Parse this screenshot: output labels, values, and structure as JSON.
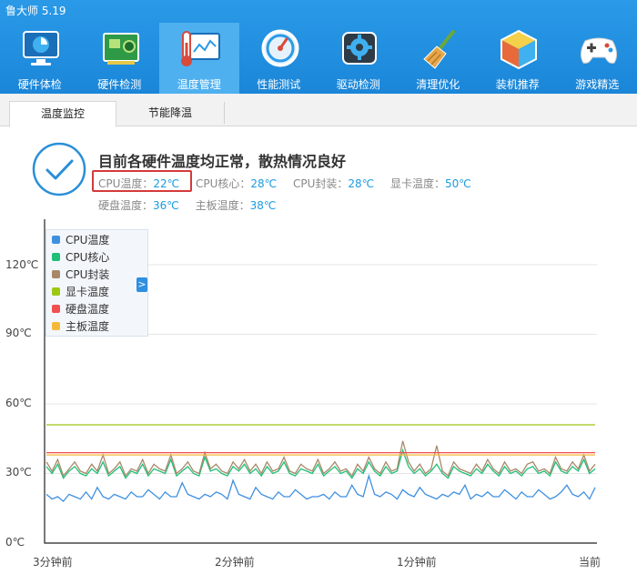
{
  "app": {
    "title": "鲁大师 5.19"
  },
  "nav": [
    {
      "label": "硬件体检",
      "icon": "monitor-check-icon"
    },
    {
      "label": "硬件检测",
      "icon": "circuit-board-icon"
    },
    {
      "label": "温度管理",
      "icon": "thermometer-icon"
    },
    {
      "label": "性能测试",
      "icon": "speedometer-icon"
    },
    {
      "label": "驱动检测",
      "icon": "driver-gear-icon"
    },
    {
      "label": "清理优化",
      "icon": "broom-icon"
    },
    {
      "label": "装机推荐",
      "icon": "cube-icon"
    },
    {
      "label": "游戏精选",
      "icon": "gamepad-icon"
    }
  ],
  "nav_active": 2,
  "tabs": [
    {
      "label": "温度监控"
    },
    {
      "label": "节能降温"
    }
  ],
  "status": {
    "title": "目前各硬件温度均正常，散热情况良好",
    "icon": "checkmark-circle-icon",
    "metrics": [
      {
        "label": "CPU温度：",
        "value": "22℃"
      },
      {
        "label": "CPU核心：",
        "value": "28℃"
      },
      {
        "label": "CPU封装：",
        "value": "28℃"
      },
      {
        "label": "显卡温度：",
        "value": "50℃"
      },
      {
        "label": "硬盘温度：",
        "value": "36℃"
      },
      {
        "label": "主板温度：",
        "value": "38℃"
      }
    ]
  },
  "legend_toggle": ">",
  "chart_data": {
    "type": "line",
    "ylim": [
      0,
      120
    ],
    "y_ticks": [
      "0℃",
      "30℃",
      "60℃",
      "90℃",
      "120℃"
    ],
    "x_ticks": [
      "3分钟前",
      "2分钟前",
      "1分钟前",
      "当前"
    ],
    "grid": true,
    "legend": "top-left",
    "series": [
      {
        "name": "CPU温度",
        "color": "#3f8fe0",
        "values": [
          21,
          19,
          20,
          18,
          21,
          20,
          19,
          22,
          19,
          24,
          20,
          19,
          21,
          20,
          19,
          22,
          20,
          20,
          23,
          21,
          19,
          22,
          20,
          20,
          26,
          21,
          20,
          19,
          21,
          20,
          22,
          21,
          19,
          27,
          21,
          20,
          19,
          24,
          21,
          20,
          19,
          22,
          20,
          20,
          23,
          21,
          19,
          20,
          20,
          21,
          19,
          22,
          20,
          20,
          25,
          21,
          20,
          29,
          21,
          20,
          22,
          21,
          19,
          23,
          21,
          20,
          24,
          21,
          20,
          19,
          21,
          20,
          22,
          21,
          25,
          19,
          21,
          20,
          22,
          20,
          20,
          23,
          21,
          19,
          22,
          20,
          20,
          23,
          21,
          19,
          20,
          22,
          25,
          21,
          20,
          22,
          19,
          24
        ]
      },
      {
        "name": "CPU核心",
        "color": "#1fbf7a",
        "values": [
          33,
          30,
          34,
          28,
          31,
          33,
          30,
          29,
          32,
          30,
          35,
          29,
          31,
          33,
          28,
          31,
          30,
          34,
          29,
          32,
          31,
          30,
          36,
          29,
          31,
          33,
          30,
          29,
          37,
          31,
          32,
          30,
          29,
          33,
          31,
          34,
          30,
          32,
          29,
          33,
          30,
          31,
          35,
          30,
          29,
          32,
          31,
          30,
          34,
          29,
          31,
          33,
          30,
          31,
          28,
          32,
          30,
          35,
          31,
          29,
          33,
          30,
          31,
          40,
          33,
          30,
          32,
          29,
          31,
          34,
          30,
          28,
          33,
          31,
          30,
          29,
          32,
          30,
          34,
          31,
          29,
          33,
          30,
          31,
          29,
          32,
          33,
          30,
          31,
          29,
          35,
          31,
          30,
          33,
          31,
          36,
          30,
          32
        ]
      },
      {
        "name": "CPU封装",
        "color": "#a98868",
        "values": [
          35,
          31,
          36,
          29,
          32,
          35,
          31,
          30,
          34,
          31,
          38,
          30,
          32,
          35,
          29,
          32,
          31,
          36,
          30,
          34,
          32,
          31,
          38,
          30,
          32,
          35,
          31,
          30,
          39,
          32,
          34,
          31,
          30,
          35,
          32,
          36,
          31,
          34,
          30,
          35,
          31,
          32,
          37,
          31,
          30,
          34,
          32,
          31,
          36,
          30,
          32,
          35,
          31,
          32,
          29,
          34,
          31,
          37,
          32,
          30,
          35,
          31,
          32,
          44,
          35,
          31,
          34,
          30,
          32,
          42,
          31,
          29,
          35,
          32,
          31,
          30,
          34,
          31,
          36,
          32,
          30,
          35,
          31,
          32,
          30,
          34,
          35,
          31,
          32,
          30,
          37,
          32,
          31,
          35,
          32,
          38,
          31,
          34
        ]
      },
      {
        "name": "显卡温度",
        "color": "#9cc813",
        "values": [
          51,
          51,
          51,
          51,
          51,
          51,
          51,
          51,
          51,
          51,
          51,
          51,
          51,
          51,
          51,
          51,
          51,
          51,
          51,
          51,
          51,
          51,
          51,
          51,
          51,
          51,
          51,
          51,
          51,
          51,
          51,
          51,
          51,
          51,
          51,
          51,
          51,
          51,
          51,
          51,
          51,
          51,
          51,
          51,
          51,
          51,
          51,
          51,
          51,
          51,
          51,
          51,
          51,
          51,
          51,
          51,
          51,
          51,
          51,
          51,
          51,
          51,
          51,
          51,
          51,
          51,
          51,
          51,
          51,
          51,
          51,
          51,
          51,
          51,
          51,
          51,
          51,
          51,
          51,
          51,
          51,
          51,
          51,
          51,
          51,
          51,
          51,
          51,
          51,
          51,
          51,
          51,
          51,
          51,
          51,
          51,
          51,
          51
        ]
      },
      {
        "name": "硬盘温度",
        "color": "#f05050",
        "values": [
          39,
          39,
          39,
          39,
          39,
          39,
          39,
          39,
          39,
          39,
          39,
          39,
          39,
          39,
          39,
          39,
          39,
          39,
          39,
          39,
          39,
          39,
          39,
          39,
          39,
          39,
          39,
          39,
          39,
          39,
          39,
          39,
          39,
          39,
          39,
          39,
          39,
          39,
          39,
          39,
          39,
          39,
          39,
          39,
          39,
          39,
          39,
          39,
          39,
          39,
          39,
          39,
          39,
          39,
          39,
          39,
          39,
          39,
          39,
          39,
          39,
          39,
          39,
          39,
          39,
          39,
          39,
          39,
          39,
          39,
          39,
          39,
          39,
          39,
          39,
          39,
          39,
          39,
          39,
          39,
          39,
          39,
          39,
          39,
          39,
          39,
          39,
          39,
          39,
          39,
          39,
          39,
          39,
          39,
          39,
          39,
          39,
          39
        ]
      },
      {
        "name": "主板温度",
        "color": "#f5b93a",
        "values": [
          38,
          38,
          38,
          38,
          38,
          38,
          38,
          38,
          38,
          38,
          38,
          38,
          38,
          38,
          38,
          38,
          38,
          38,
          38,
          38,
          38,
          38,
          38,
          38,
          38,
          38,
          38,
          38,
          38,
          38,
          38,
          38,
          38,
          38,
          38,
          38,
          38,
          38,
          38,
          38,
          38,
          38,
          38,
          38,
          38,
          38,
          38,
          38,
          38,
          38,
          38,
          38,
          38,
          38,
          38,
          38,
          38,
          38,
          38,
          38,
          38,
          38,
          38,
          38,
          38,
          38,
          38,
          38,
          38,
          38,
          38,
          38,
          38,
          38,
          38,
          38,
          38,
          38,
          38,
          38,
          38,
          38,
          38,
          38,
          38,
          38,
          38,
          38,
          38,
          38,
          38,
          38,
          38,
          38,
          38,
          38,
          38,
          38
        ]
      }
    ]
  }
}
